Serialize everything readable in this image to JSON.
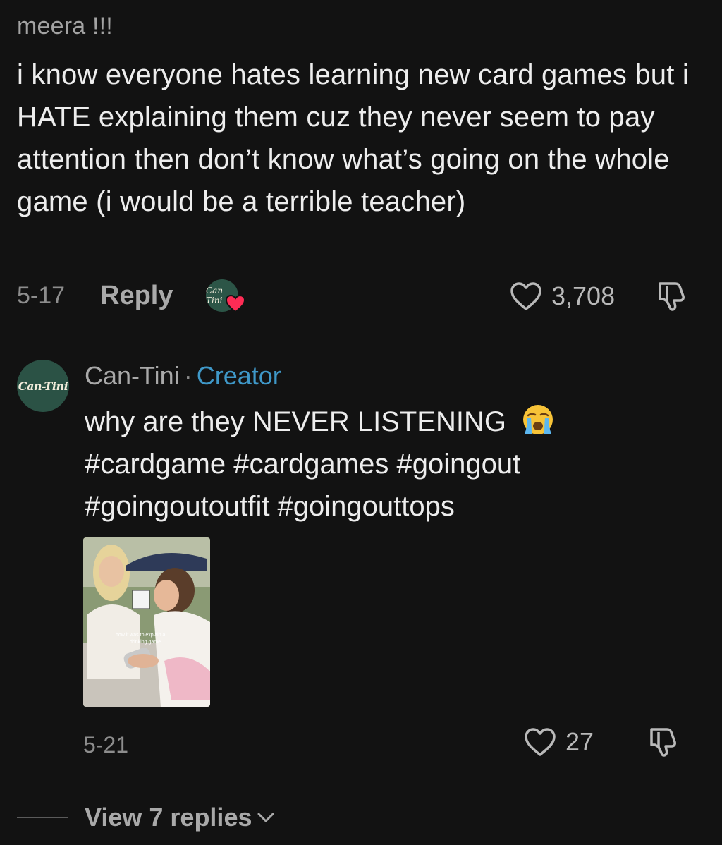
{
  "comment": {
    "username": "meera !!!",
    "text": "i know everyone hates learning new card games but i HATE explaining them cuz they never seem to pay attention then don’t know what’s going on the whole game (i would be a terrible teacher)",
    "date": "5-17",
    "reply_label": "Reply",
    "like_count": "3,708",
    "creator_avatar_text": "Can-Tini",
    "icons": {
      "like": "heart-outline-icon",
      "dislike": "thumbs-down-icon",
      "creator_liked": "red-heart-icon"
    }
  },
  "reply": {
    "avatar_text": "Can-Tini",
    "username": "Can-Tini",
    "separator": "·",
    "badge": "Creator",
    "text": "why are they NEVER LISTENING",
    "emoji": "loudly-crying-face",
    "hashtags": "#cardgame #cardgames #goingout #goingoutoutfit #goingouttops",
    "video_caption": "how it was to explain a drinking game",
    "date": "5-21",
    "like_count": "27"
  },
  "view_replies": {
    "label": "View 7 replies",
    "icon": "chevron-down-icon"
  },
  "colors": {
    "background": "#121212",
    "text": "#ededed",
    "secondary": "#a9a9a9",
    "creator_badge": "#3f98c8",
    "avatar_green": "#2b5245",
    "heart_red": "#fe2c55"
  }
}
